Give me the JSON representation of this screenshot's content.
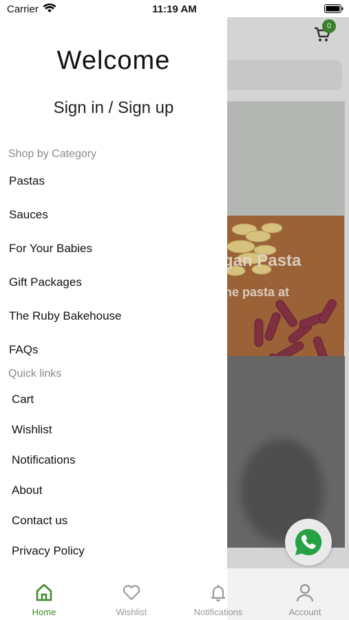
{
  "status_bar": {
    "carrier": "Carrier",
    "time": "11:19 AM"
  },
  "background": {
    "cart_count": "0",
    "banner_title": "gan Pasta",
    "banner_subtitle": "ne pasta at"
  },
  "drawer": {
    "welcome": "Welcome",
    "sign_in": "Sign in / Sign up",
    "category_header": "Shop by Category",
    "categories": [
      "Pastas",
      "Sauces",
      "For Your Babies",
      "Gift Packages",
      "The Ruby Bakehouse",
      "FAQs"
    ],
    "quick_links_header": "Quick links",
    "quick_links": [
      "Cart",
      "Wishlist",
      "Notifications",
      "About",
      "Contact us",
      "Privacy Policy"
    ]
  },
  "tabs": [
    {
      "label": "Home",
      "icon": "home-icon",
      "active": true
    },
    {
      "label": "Wishlist",
      "icon": "heart-icon",
      "active": false
    },
    {
      "label": "Notifications",
      "icon": "bell-icon",
      "active": false
    },
    {
      "label": "Account",
      "icon": "person-icon",
      "active": false
    }
  ],
  "colors": {
    "accent": "#3f8a2e",
    "whatsapp": "#25a244"
  }
}
